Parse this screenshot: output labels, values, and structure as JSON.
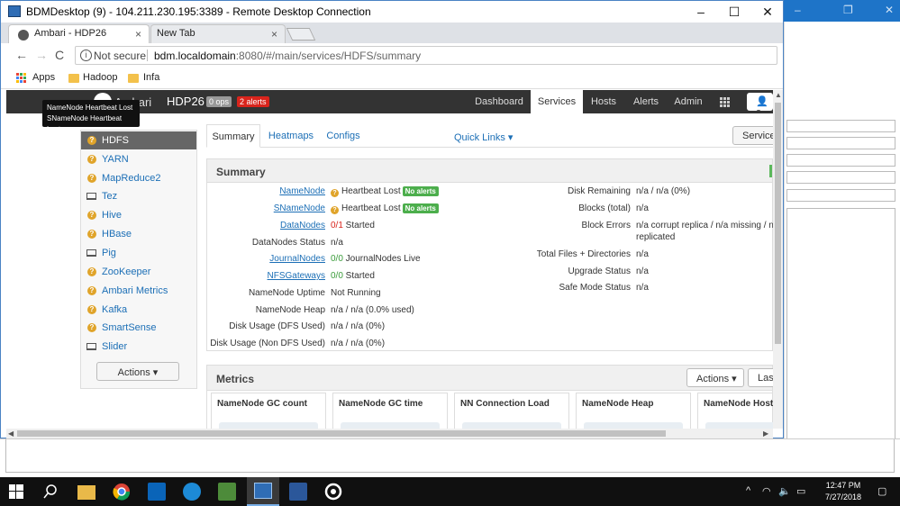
{
  "rdp": {
    "title": "BDMDesktop (9) - 104.211.230.195:3389 - Remote Desktop Connection",
    "minimize": "–",
    "maximize": "☐",
    "close": "✕"
  },
  "browser": {
    "tabs": [
      {
        "label": "Ambari - HDP26",
        "close": "×"
      },
      {
        "label": "New Tab",
        "close": "×"
      }
    ],
    "back": "←",
    "forward": "→",
    "reload": "C",
    "info_glyph": "i",
    "not_secure": "Not secure",
    "url_host": "bdm.localdomain",
    "url_rest": ":8080/#/main/services/HDFS/summary",
    "bookmarks": [
      "Apps",
      "Hadoop",
      "Infa"
    ]
  },
  "ambari": {
    "brand": "Ambari",
    "cluster": "HDP26",
    "ops_badge": "0 ops",
    "alerts_badge": "2 alerts",
    "nav": [
      "Dashboard",
      "Services",
      "Hosts",
      "Alerts",
      "Admin"
    ],
    "user_label": "a",
    "tooltip": [
      "NameNode Heartbeat Lost",
      "SNameNode Heartbeat Lost"
    ]
  },
  "sidebar": {
    "services": [
      {
        "name": "HDFS",
        "icon": "warning"
      },
      {
        "name": "YARN",
        "icon": "warning"
      },
      {
        "name": "MapReduce2",
        "icon": "warning"
      },
      {
        "name": "Tez",
        "icon": "laptop"
      },
      {
        "name": "Hive",
        "icon": "warning"
      },
      {
        "name": "HBase",
        "icon": "warning"
      },
      {
        "name": "Pig",
        "icon": "laptop"
      },
      {
        "name": "ZooKeeper",
        "icon": "warning"
      },
      {
        "name": "Ambari Metrics",
        "icon": "warning"
      },
      {
        "name": "Kafka",
        "icon": "warning"
      },
      {
        "name": "SmartSense",
        "icon": "warning"
      },
      {
        "name": "Slider",
        "icon": "laptop"
      }
    ],
    "warn_glyph": "?",
    "actions": "Actions ▾"
  },
  "subtabs": {
    "items": [
      "Summary",
      "Heatmaps",
      "Configs"
    ],
    "quick_links": "Quick Links ▾",
    "service_actions": "Service"
  },
  "summary": {
    "title": "Summary",
    "no_alerts": "No alerts",
    "left": [
      {
        "label": "NameNode",
        "value": "Heartbeat Lost"
      },
      {
        "label": "SNameNode",
        "value": "Heartbeat Lost"
      },
      {
        "label": "DataNodes",
        "value_count": "0/1",
        "value": " Started"
      },
      {
        "label": "DataNodes Status",
        "value": "n/a"
      },
      {
        "label": "JournalNodes",
        "value_count": "0/0",
        "value": " JournalNodes Live"
      },
      {
        "label": "NFSGateways",
        "value_count": "0/0",
        "value": " Started"
      },
      {
        "label": "NameNode Uptime",
        "value": "Not Running"
      },
      {
        "label": "NameNode Heap",
        "value": "n/a / n/a (0.0% used)"
      },
      {
        "label": "Disk Usage (DFS Used)",
        "value": "n/a / n/a (0%)"
      },
      {
        "label": "Disk Usage (Non DFS Used)",
        "value": "n/a / n/a (0%)"
      }
    ],
    "right": [
      {
        "label": "Disk Remaining",
        "value": "n/a / n/a (0%)"
      },
      {
        "label": "Blocks (total)",
        "value": "n/a"
      },
      {
        "label": "Block Errors",
        "value": "n/a corrupt replica / n/a missing / n/a",
        "value2": "replicated"
      },
      {
        "label": "Total Files + Directories",
        "value": "n/a"
      },
      {
        "label": "Upgrade Status",
        "value": "n/a"
      },
      {
        "label": "Safe Mode Status",
        "value": "n/a"
      }
    ]
  },
  "metrics": {
    "title": "Metrics",
    "actions": "Actions ▾",
    "last": "Last",
    "cards": [
      "NameNode GC count",
      "NameNode GC time",
      "NN Connection Load",
      "NameNode Heap",
      "NameNode Host L"
    ]
  },
  "scroll": {
    "up": "▲",
    "down": "▼",
    "left": "◀",
    "right": "▶"
  },
  "taskbar": {
    "time": "12:47 PM",
    "date": "7/27/2018",
    "tray_chevron": "^"
  }
}
